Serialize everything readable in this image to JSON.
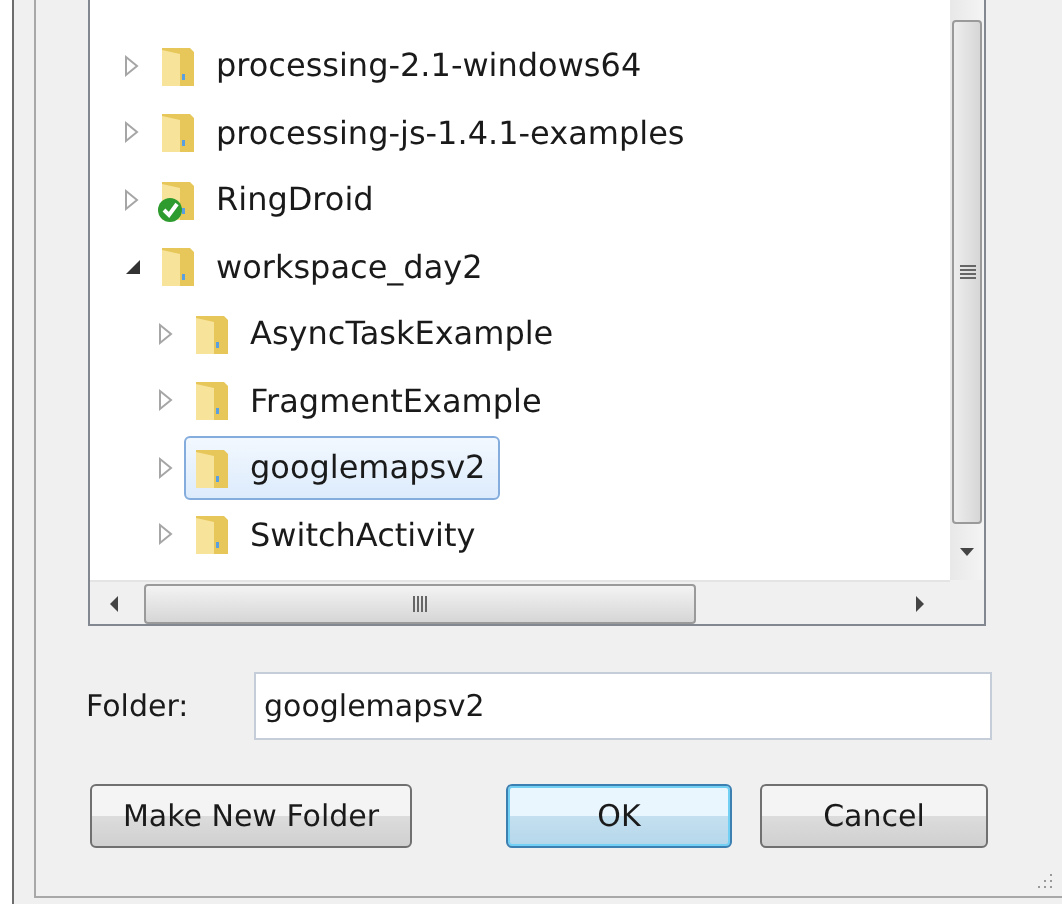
{
  "tree": {
    "items": [
      {
        "label": "processing-2.1-windows64",
        "expanded": false,
        "selected": false,
        "synced": false
      },
      {
        "label": "processing-js-1.4.1-examples",
        "expanded": false,
        "selected": false,
        "synced": false
      },
      {
        "label": "RingDroid",
        "expanded": false,
        "selected": false,
        "synced": true
      },
      {
        "label": "workspace_day2",
        "expanded": true,
        "selected": false,
        "synced": false,
        "children": [
          {
            "label": "AsyncTaskExample",
            "expanded": false,
            "selected": false,
            "synced": false
          },
          {
            "label": "FragmentExample",
            "expanded": false,
            "selected": false,
            "synced": false
          },
          {
            "label": "googlemapsv2",
            "expanded": false,
            "selected": true,
            "synced": false
          },
          {
            "label": "SwitchActivity",
            "expanded": false,
            "selected": false,
            "synced": false
          }
        ]
      }
    ]
  },
  "folder": {
    "label": "Folder:",
    "value": "googlemapsv2"
  },
  "buttons": [
    {
      "label": "Make New Folder",
      "default": false
    },
    {
      "label": "OK",
      "default": true
    },
    {
      "label": "Cancel",
      "default": false
    }
  ]
}
